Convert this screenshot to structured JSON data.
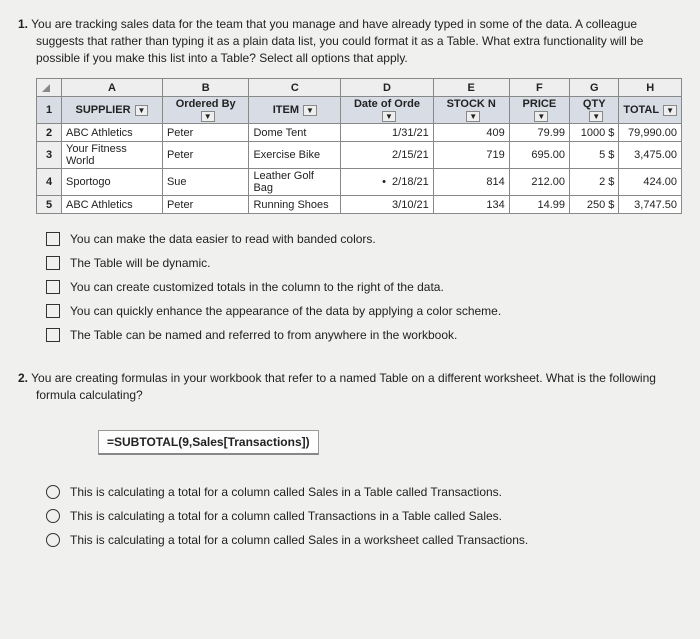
{
  "q1": {
    "num": "1.",
    "text": "You are tracking sales data for the team that you manage and have already typed in some of the data. A colleague suggests that rather than typing it as a plain data list, you could format it as a Table. What extra functionality will be possible if you make this list into a Table? Select all options that apply.",
    "columns": [
      "A",
      "B",
      "C",
      "D",
      "E",
      "F",
      "G",
      "H"
    ],
    "header_row_num": "1",
    "headers": [
      "SUPPLIER",
      "Ordered By",
      "ITEM",
      "Date of Orde",
      "STOCK N",
      "PRICE",
      "QTY",
      "TOTAL"
    ],
    "rows": [
      {
        "n": "2",
        "supplier": "ABC Athletics",
        "by": "Peter",
        "item": "Dome Tent",
        "date": "1/31/21",
        "stock": "409",
        "price": "79.99",
        "qty": "1000",
        "total": "79,990.00"
      },
      {
        "n": "3",
        "supplier": "Your Fitness World",
        "by": "Peter",
        "item": "Exercise Bike",
        "date": "2/15/21",
        "stock": "719",
        "price": "695.00",
        "qty": "5",
        "total": "3,475.00"
      },
      {
        "n": "4",
        "supplier": "Sportogo",
        "by": "Sue",
        "item": "Leather Golf Bag",
        "date": "2/18/21",
        "stock": "814",
        "price": "212.00",
        "qty": "2",
        "total": "424.00"
      },
      {
        "n": "5",
        "supplier": "ABC Athletics",
        "by": "Peter",
        "item": "Running Shoes",
        "date": "3/10/21",
        "stock": "134",
        "price": "14.99",
        "qty": "250",
        "total": "3,747.50"
      }
    ],
    "options": [
      "You can make the data easier to read with banded colors.",
      "The Table will be dynamic.",
      "You can create customized totals in the column to the right of the data.",
      "You can quickly enhance the appearance of the data by applying a color scheme.",
      "The Table can be named and referred to from anywhere in the workbook."
    ]
  },
  "q2": {
    "num": "2.",
    "text": "You are creating formulas in your workbook that refer to a named Table on a different worksheet. What is the following formula calculating?",
    "formula": "=SUBTOTAL(9,Sales[Transactions])",
    "options": [
      "This is calculating a total for a column called Sales in a Table called Transactions.",
      "This is calculating a total for a column called Transactions in a Table called Sales.",
      "This is calculating a total for a column called Sales in a worksheet called Transactions."
    ]
  },
  "currency": "$",
  "arrow": "▼",
  "date_marker": "•"
}
